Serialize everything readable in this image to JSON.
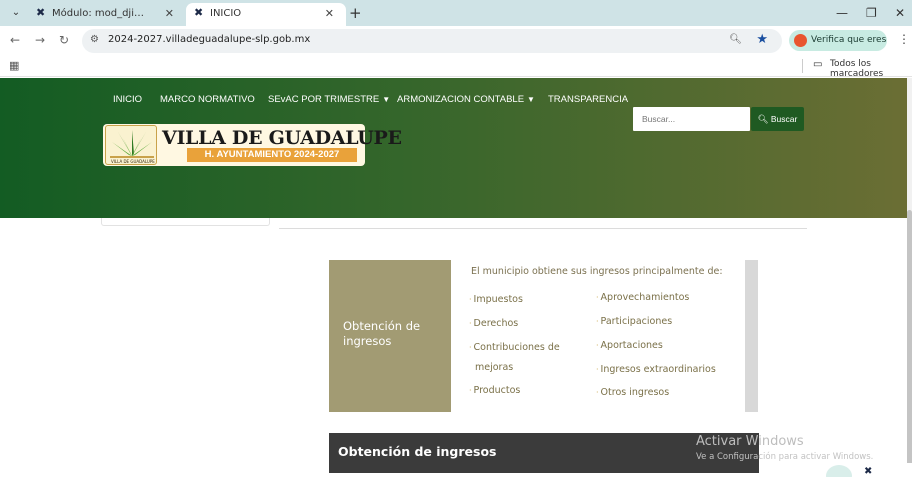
{
  "browser": {
    "tabs": [
      {
        "title": "Módulo: mod_djimageslider - I",
        "active": false,
        "icon": "joomla-icon"
      },
      {
        "title": "INICIO",
        "active": true,
        "icon": "joomla-icon"
      }
    ],
    "url": "2024-2027.villadeguadalupe-slp.gob.mx",
    "verify_label": "Verifica que eres tú",
    "bookmarks_label": "Todos los marcadores"
  },
  "site": {
    "nav": [
      {
        "label": "INICIO",
        "dropdown": false
      },
      {
        "label": "MARCO NORMATIVO",
        "dropdown": false
      },
      {
        "label": "SEvAC POR TRIMESTRE",
        "dropdown": true
      },
      {
        "label": "ARMONIZACION CONTABLE",
        "dropdown": true
      },
      {
        "label": "TRANSPARENCIA",
        "dropdown": false
      }
    ],
    "logo": {
      "title": "VILLA DE GUADALUPE",
      "subtitle": "H. AYUNTAMIENTO 2024-2027",
      "emblem_text": "VILLA DE GUADALUPE"
    },
    "search": {
      "placeholder": "Buscar...",
      "button": "Buscar"
    }
  },
  "infographic": {
    "left_title": "Obtención de ingresos",
    "intro": "El municipio obtiene sus ingresos principalmente de:",
    "col1": [
      "Impuestos",
      "Derechos",
      "Contribuciones de",
      "mejoras",
      "Productos"
    ],
    "col2": [
      "Aprovechamientos",
      "Participaciones",
      "Aportaciones",
      "Ingresos extraordinarios",
      "Otros ingresos"
    ]
  },
  "panel": {
    "title": "Obtención de ingresos"
  },
  "watermark": {
    "title": "Activar Windows",
    "subtitle": "Ve a Configuración para activar Windows."
  },
  "colors": {
    "header_start": "#135c23",
    "header_end": "#6b6e34",
    "accent": "#e9a23a",
    "infographic": "#a29b73"
  }
}
